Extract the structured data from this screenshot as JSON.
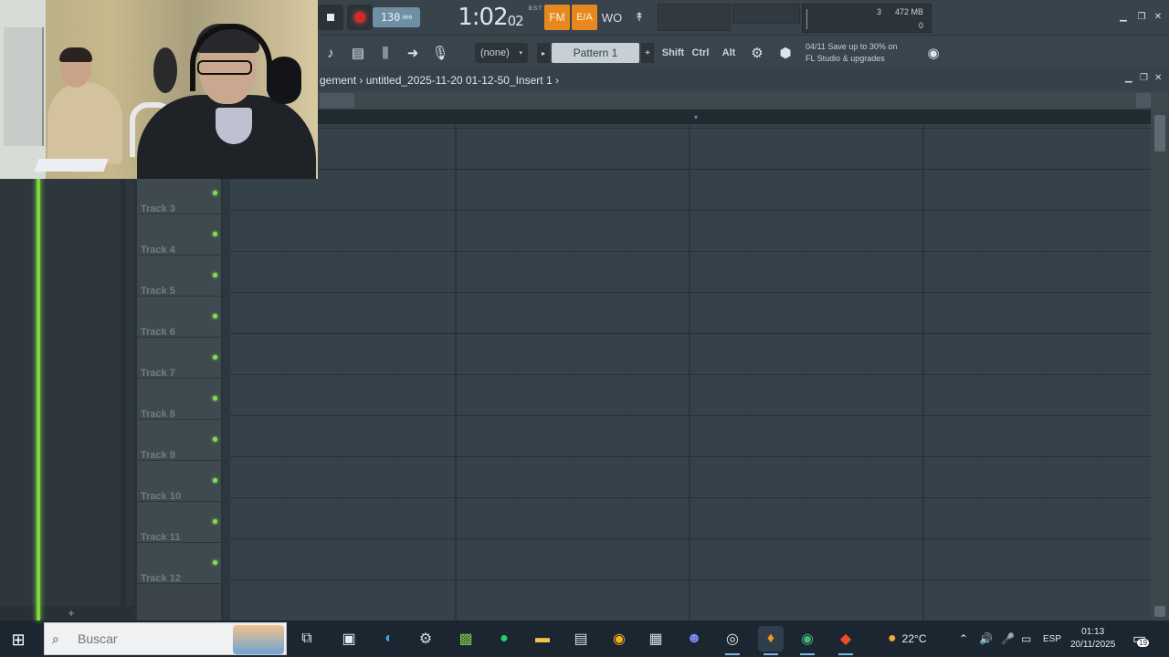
{
  "webcam": {
    "label": "webcam-overlay"
  },
  "transport": {
    "tempo": "130",
    "tempo_unit": "000",
    "time": "1:02",
    "time_small": "02",
    "time_sig": "B:S:T",
    "btn_o1": "FM",
    "btn_o2": "E/A",
    "btn_g1": "WO",
    "btn_g2": "↟"
  },
  "monitor": {
    "cpu": "3",
    "memory": "472 MB",
    "poly": "0"
  },
  "toolbar2": {
    "pattern_none": "(none)",
    "pattern": "Pattern 1",
    "shift": "Shift",
    "ctrl": "Ctrl",
    "alt": "Alt",
    "news_line1": "04/11  Save up to 30% on",
    "news_line2": "FL Studio & upgrades"
  },
  "playlist": {
    "title": "gement › untitled_2025-11-20 01-12-50_Insert 1 ›",
    "tracks": [
      {
        "name": "Track 3"
      },
      {
        "name": "Track 4"
      },
      {
        "name": "Track 5"
      },
      {
        "name": "Track 6"
      },
      {
        "name": "Track 7"
      },
      {
        "name": "Track 8"
      },
      {
        "name": "Track 9"
      },
      {
        "name": "Track 10"
      },
      {
        "name": "Track 11"
      },
      {
        "name": "Track 12"
      }
    ],
    "left_panel_add": "+"
  },
  "taskbar": {
    "search_placeholder": "Buscar",
    "weather": "22°C",
    "lang": "ESP",
    "clock_time": "01:13",
    "clock_date": "20/11/2025",
    "notifications": "19"
  },
  "colors": {
    "accent_orange": "#e6881f",
    "playhead_green": "#7fd639",
    "record_red": "#d22a2a"
  }
}
